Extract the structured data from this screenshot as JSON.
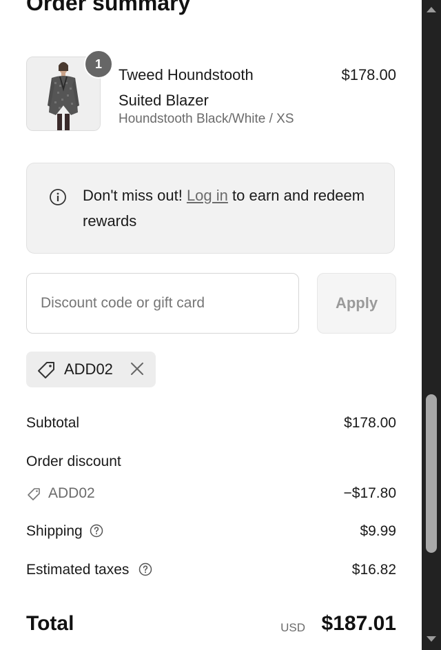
{
  "summary": {
    "title": "Order summary"
  },
  "product": {
    "quantity": "1",
    "name": "Tweed Houndstooth Suited Blazer",
    "variant": "Houndstooth Black/White / XS",
    "price": "$178.00"
  },
  "rewards_banner": {
    "prefix": "Don't miss out!",
    "link": "Log in",
    "suffix": "to earn and redeem rewards",
    "icon": "info-icon"
  },
  "discount": {
    "placeholder": "Discount code or gift card",
    "apply_label": "Apply",
    "applied_code": "ADD02"
  },
  "totals": {
    "subtotal_label": "Subtotal",
    "subtotal_value": "$178.00",
    "order_discount_label": "Order discount",
    "discount_code": "ADD02",
    "discount_value": "−$17.80",
    "shipping_label": "Shipping",
    "shipping_value": "$9.99",
    "taxes_label": "Estimated taxes",
    "taxes_value": "$16.82",
    "total_label": "Total",
    "currency": "USD",
    "total_value": "$187.01"
  },
  "colors": {
    "banner_bg": "#f2f2f2",
    "link": "#6b6b6b",
    "scrollbar_track": "#222222"
  }
}
